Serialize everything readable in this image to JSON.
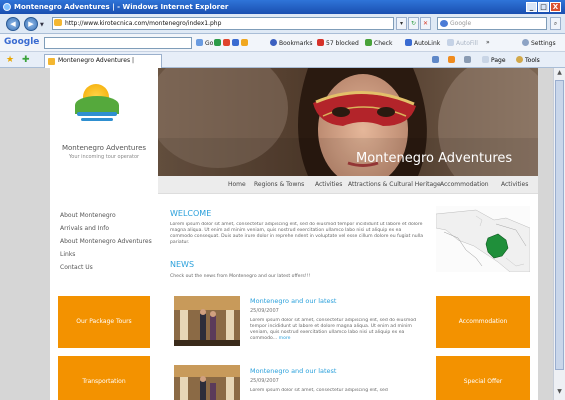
{
  "window": {
    "title": "Montenegro Adventures | - Windows Internet Explorer",
    "minimize": "_",
    "maximize": "□",
    "close": "X"
  },
  "address_bar": {
    "url": "http://www.kirotecnica.com/montenegro/index1.php",
    "search_placeholder": "Google"
  },
  "google_toolbar": {
    "logo": "Google",
    "go_label": "Go",
    "bookmarks": "Bookmarks",
    "blocked": "57 blocked",
    "check": "Check",
    "autolink": "AutoLink",
    "autofill": "AutoFill",
    "more": "»",
    "settings": "Settings"
  },
  "tab_bar": {
    "tab_label": "Montenegro Adventures |",
    "page_menu": "Page",
    "tools_menu": "Tools"
  },
  "site": {
    "name": "Montenegro Adventures",
    "tagline": "Your incoming tour operator",
    "hero_title": "Montenegro Adventures",
    "nav": [
      "Home",
      "Regions & Towns",
      "Activities",
      "Attractions & Cultural Heritage",
      "Accommodation",
      "Activities"
    ],
    "left_nav": [
      "About Montenegro",
      "Arrivals and Info",
      "About Montenegro Adventures",
      "Links",
      "Contact Us"
    ],
    "left_buttons": [
      "Our Package Tours",
      "Transportation"
    ],
    "right_buttons": [
      "Accommodation",
      "Special Offer"
    ],
    "welcome_heading": "WELCOME",
    "welcome_text": "Lorem ipsum dolor sit amet, consectetur adipiscing elit, sed do eiusmod tempor incididunt ut labore et dolore magna aliqua. Ut enim ad minim veniam, quis nostrud exercitation ullamco labo nisi ut aliquip ex ea commodo consequat. Duis aute irure dolor in reprehe ndent in voluptate vel esse cillum dolore eu fugiat nulla pariatur.",
    "news_heading": "NEWS",
    "news_intro": "Check out the news from Montenegro and our latest offers!!!",
    "news": [
      {
        "title": "Montenegro and our latest",
        "date": "25/09/2007",
        "text": "Lorem ipsum dolor sit amet, consectetur adipiscing elit, sed do eiusmod tempor incididunt ut labore et dolore magna aliqua. Ut enim ad minim veniam, quis nostrud exercitation ullamco labo nisi ut aliquip ex ea commodo...",
        "more": "more"
      },
      {
        "title": "Montenegro and our latest",
        "date": "25/09/2007",
        "text": "Lorem ipsum dolor sit amet, consectetur adipiscing elit, sed",
        "more": ""
      }
    ]
  },
  "colors": {
    "accent_blue": "#2aa0db",
    "orange": "#f39200",
    "ie_blue": "#1a4fb0"
  }
}
